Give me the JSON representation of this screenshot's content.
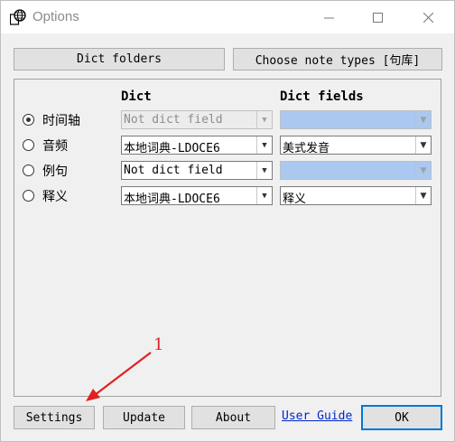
{
  "window": {
    "title": "Options"
  },
  "top_buttons": {
    "dict_folders": "Dict folders",
    "choose_note_types": "Choose note types [句库]"
  },
  "columns": {
    "dict": "Dict",
    "dict_fields": "Dict fields"
  },
  "rows": [
    {
      "label": "时间轴",
      "selected": true,
      "dict": "Not dict field",
      "dict_disabled": true,
      "field": "",
      "field_disabled": true
    },
    {
      "label": "音频",
      "selected": false,
      "dict": "本地词典-LDOCE6",
      "dict_disabled": false,
      "field": "美式发音",
      "field_disabled": false
    },
    {
      "label": "例句",
      "selected": false,
      "dict": "Not dict field",
      "dict_disabled": false,
      "field": "",
      "field_disabled": true
    },
    {
      "label": "释义",
      "selected": false,
      "dict": "本地词典-LDOCE6",
      "dict_disabled": false,
      "field": "释义",
      "field_disabled": false
    }
  ],
  "bottom": {
    "settings": "Settings",
    "update": "Update",
    "about": "About",
    "user_guide": "User Guide",
    "ok": "OK"
  },
  "annotation": {
    "label": "1",
    "color": "#e02020"
  }
}
